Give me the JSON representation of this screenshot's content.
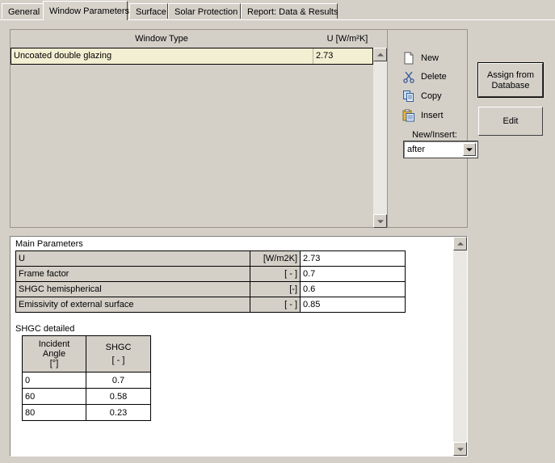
{
  "tabs": [
    {
      "label": "General",
      "active": false
    },
    {
      "label": "Window Parameters",
      "active": true
    },
    {
      "label": "Surface",
      "active": false
    },
    {
      "label": "Solar Protection",
      "active": false
    },
    {
      "label": "Report: Data & Results",
      "active": false
    }
  ],
  "grid": {
    "headers": {
      "window_type": "Window Type",
      "u_value": "U [W/m²K]"
    },
    "rows": [
      {
        "window_type": "Uncoated double glazing",
        "u_value": "2.73"
      }
    ]
  },
  "actions": {
    "new": "New",
    "delete": "Delete",
    "copy": "Copy",
    "insert": "Insert",
    "new_insert_label": "New/Insert:",
    "new_insert_value": "after"
  },
  "side_buttons": {
    "assign_line1": "Assign from",
    "assign_line2": "Database",
    "edit": "Edit"
  },
  "main_parameters": {
    "title": "Main Parameters",
    "rows": [
      {
        "name": "U",
        "unit": "[W/m2K]",
        "value": "2.73"
      },
      {
        "name": "Frame factor",
        "unit": "[ - ]",
        "value": "0.7"
      },
      {
        "name": "SHGC hemispherical",
        "unit": "[-]",
        "value": "0.6"
      },
      {
        "name": "Emissivity of external surface",
        "unit": "[ - ]",
        "value": "0.85"
      }
    ]
  },
  "shgc_detailed": {
    "title": "SHGC detailed",
    "headers": {
      "angle_l1": "Incident",
      "angle_l2": "Angle",
      "angle_l3": "[°]",
      "shgc_l1": "SHGC",
      "shgc_l2": "[ - ]"
    },
    "rows": [
      {
        "angle": "0",
        "shgc": "0.7"
      },
      {
        "angle": "60",
        "shgc": "0.58"
      },
      {
        "angle": "80",
        "shgc": "0.23"
      }
    ]
  },
  "colors": {
    "window_bg": "#d4d0c8",
    "selected_row": "#f2efd2",
    "panel_white": "#ffffff",
    "header_gray": "#d4d0c8"
  }
}
